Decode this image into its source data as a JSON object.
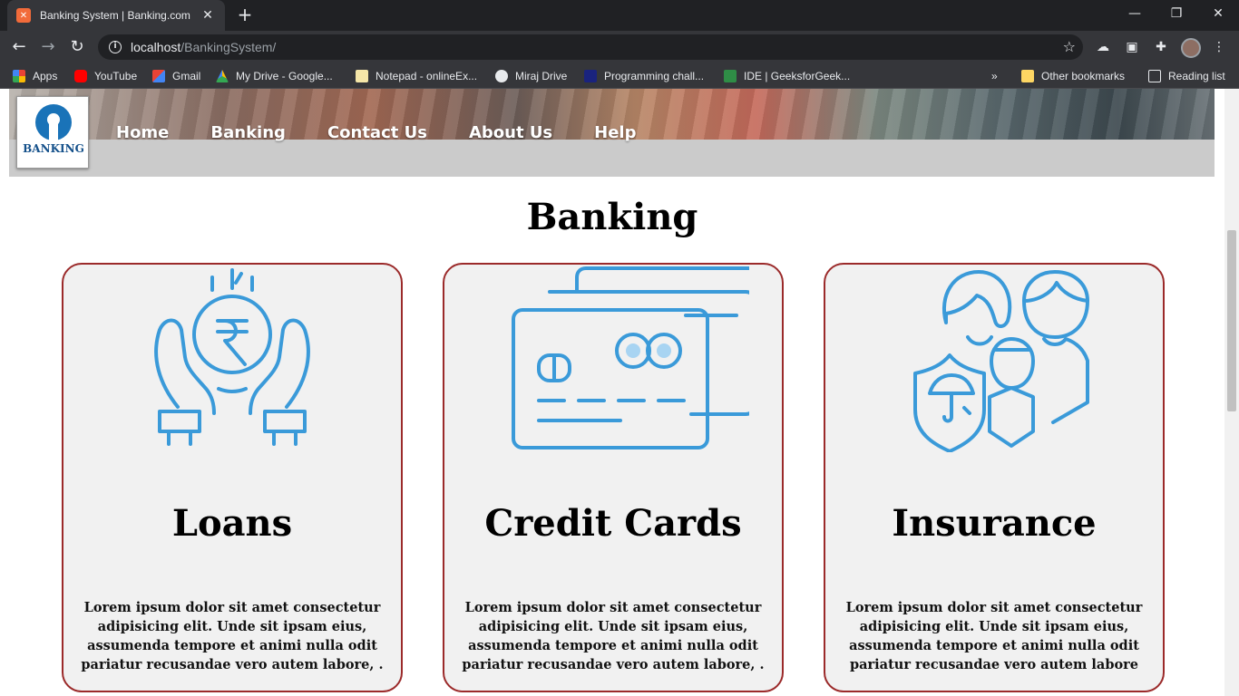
{
  "browser": {
    "tab_title": "Banking System | Banking.com",
    "url_host": "localhost",
    "url_path": "/BankingSystem/",
    "bookmarks": [
      {
        "label": "Apps",
        "icon": "apps-grid-icon",
        "color": "#ea4335"
      },
      {
        "label": "YouTube",
        "icon": "youtube-icon",
        "color": "#ff0000"
      },
      {
        "label": "Gmail",
        "icon": "gmail-icon",
        "color": "#ea4335"
      },
      {
        "label": "My Drive - Google...",
        "icon": "google-drive-icon",
        "color": "#34a853"
      },
      {
        "label": "Notepad - onlineEx...",
        "icon": "notepad-icon",
        "color": "#f5e6a8"
      },
      {
        "label": "Miraj Drive",
        "icon": "globe-icon",
        "color": "#e8eaed"
      },
      {
        "label": "Programming chall...",
        "icon": "programming-icon",
        "color": "#1a237e"
      },
      {
        "label": "IDE | GeeksforGeek...",
        "icon": "geeksforgeeks-icon",
        "color": "#2f8d46"
      }
    ],
    "overflow_label": "»",
    "other_bookmarks": "Other bookmarks",
    "reading_list": "Reading list"
  },
  "site": {
    "logo_text": "BANKING",
    "nav": [
      "Home",
      "Banking",
      "Contact Us",
      "About Us",
      "Help"
    ],
    "section_title": "Banking",
    "accent_color": "#9b2a2a",
    "icon_color": "#3a9ad9",
    "cards": [
      {
        "icon": "loan-hands-rupee-icon",
        "title": "Loans",
        "text": "Lorem ipsum dolor sit amet consectetur adipisicing elit. Unde sit ipsam eius, assumenda tempore et animi nulla odit pariatur recusandae vero autem labore, ."
      },
      {
        "icon": "credit-card-icon",
        "title": "Credit Cards",
        "text": "Lorem ipsum dolor sit amet consectetur adipisicing elit. Unde sit ipsam eius, assumenda tempore et animi nulla odit pariatur recusandae vero autem labore, ."
      },
      {
        "icon": "family-insurance-icon",
        "title": "Insurance",
        "text": "Lorem ipsum dolor sit amet consectetur adipisicing elit. Unde sit ipsam eius, assumenda tempore et animi nulla odit pariatur recusandae vero autem labore"
      }
    ]
  }
}
